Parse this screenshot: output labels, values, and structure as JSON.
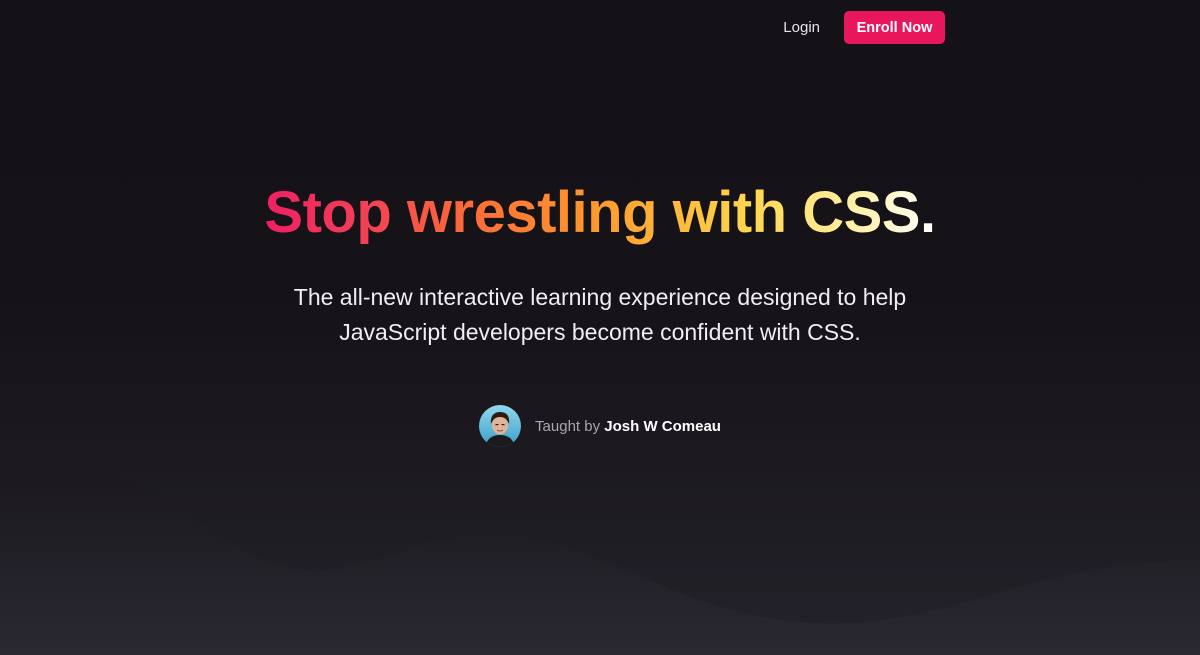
{
  "nav": {
    "login_label": "Login",
    "enroll_label": "Enroll Now"
  },
  "hero": {
    "headline": "Stop wrestling with CSS.",
    "subtitle": "The all-new interactive learning experience designed to help JavaScript developers become confident with CSS."
  },
  "author": {
    "prefix": "Taught by",
    "name": "Josh W Comeau",
    "avatar_icon": "avatar-photo-icon"
  },
  "colors": {
    "background": "#141217",
    "accent": "#e8175d",
    "gradient": [
      "#ef1f63",
      "#fb6a3a",
      "#fd9b2c",
      "#ffd64b",
      "#ffffff"
    ]
  }
}
